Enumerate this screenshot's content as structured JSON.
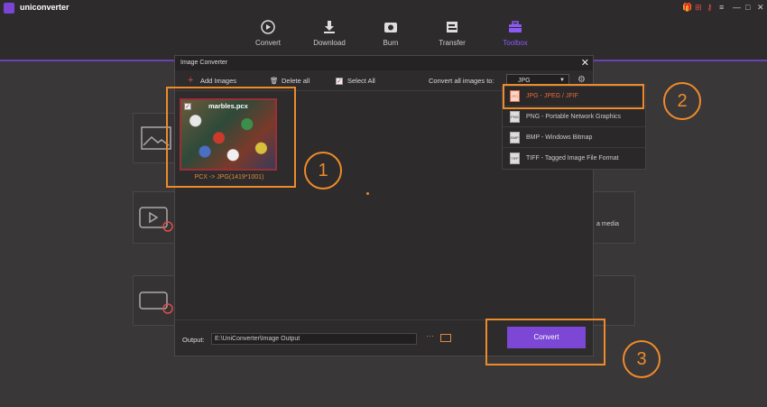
{
  "app": {
    "name": "uniconverter"
  },
  "nav": {
    "items": [
      {
        "label": "Convert"
      },
      {
        "label": "Download"
      },
      {
        "label": "Burn"
      },
      {
        "label": "Transfer"
      },
      {
        "label": "Toolbox"
      }
    ],
    "active_index": 4
  },
  "background": {
    "partial_text": "a media"
  },
  "dialog": {
    "title": "Image Converter",
    "toolbar": {
      "add_images": "Add Images",
      "delete_all": "Delete all",
      "select_all": "Select All",
      "convert_all_label": "Convert all images to:",
      "format_value": "JPG"
    },
    "image": {
      "filename": "marbles.pcx",
      "caption": "PCX -> JPG(1419*1001)",
      "checked": true
    },
    "formats": [
      {
        "label": "JPG - JPEG / JFIF",
        "icon": "JPG",
        "selected": true
      },
      {
        "label": "PNG - Portable Network Graphics",
        "icon": "PNG",
        "selected": false
      },
      {
        "label": "BMP - Windows Bitmap",
        "icon": "BMP",
        "selected": false
      },
      {
        "label": "TIFF - Tagged Image File Format",
        "icon": "TIFF",
        "selected": false
      }
    ],
    "footer": {
      "output_label": "Output:",
      "output_path": "E:\\UniConverter\\Image Output",
      "more": "···",
      "convert_label": "Convert"
    }
  },
  "callouts": [
    "1",
    "2",
    "3"
  ],
  "colors": {
    "accent": "#7b47d4",
    "highlight": "#ef8a2a",
    "format_selected": "#e86a3a"
  }
}
